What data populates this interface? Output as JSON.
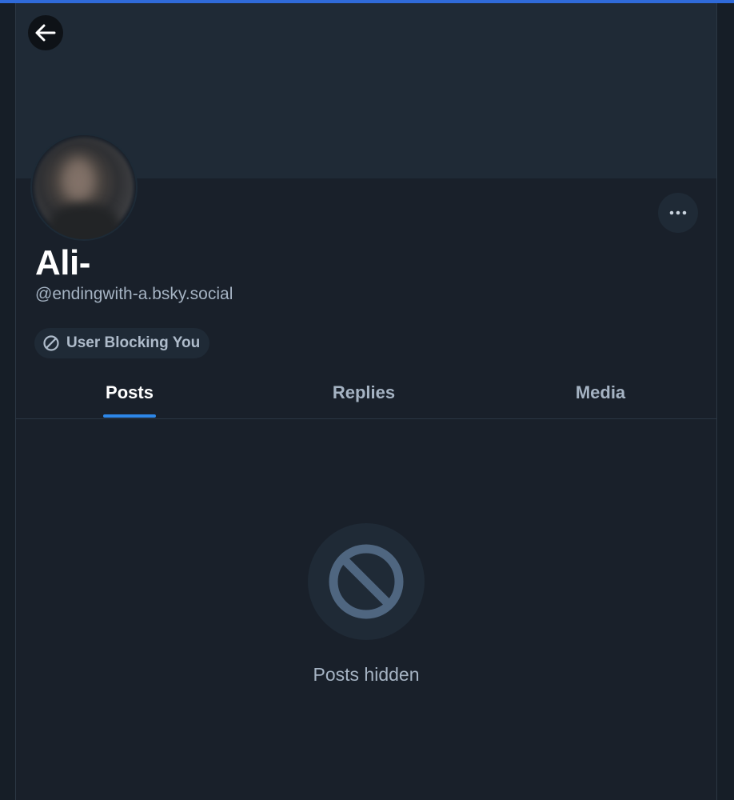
{
  "profile": {
    "display_name": "Ali-",
    "handle": "@endingwith-a.bsky.social",
    "status_badge": "User Blocking You"
  },
  "header": {
    "back_icon": "arrow-left-icon",
    "more_icon": "ellipsis-icon"
  },
  "tabs": [
    {
      "label": "Posts",
      "active": true
    },
    {
      "label": "Replies",
      "active": false
    },
    {
      "label": "Media",
      "active": false
    }
  ],
  "feed": {
    "empty_icon": "blocked-icon",
    "empty_message": "Posts hidden"
  },
  "colors": {
    "background": "#19202a",
    "banner": "#1f2a36",
    "accent": "#2d87e8",
    "muted_text": "#a5b3c3"
  }
}
